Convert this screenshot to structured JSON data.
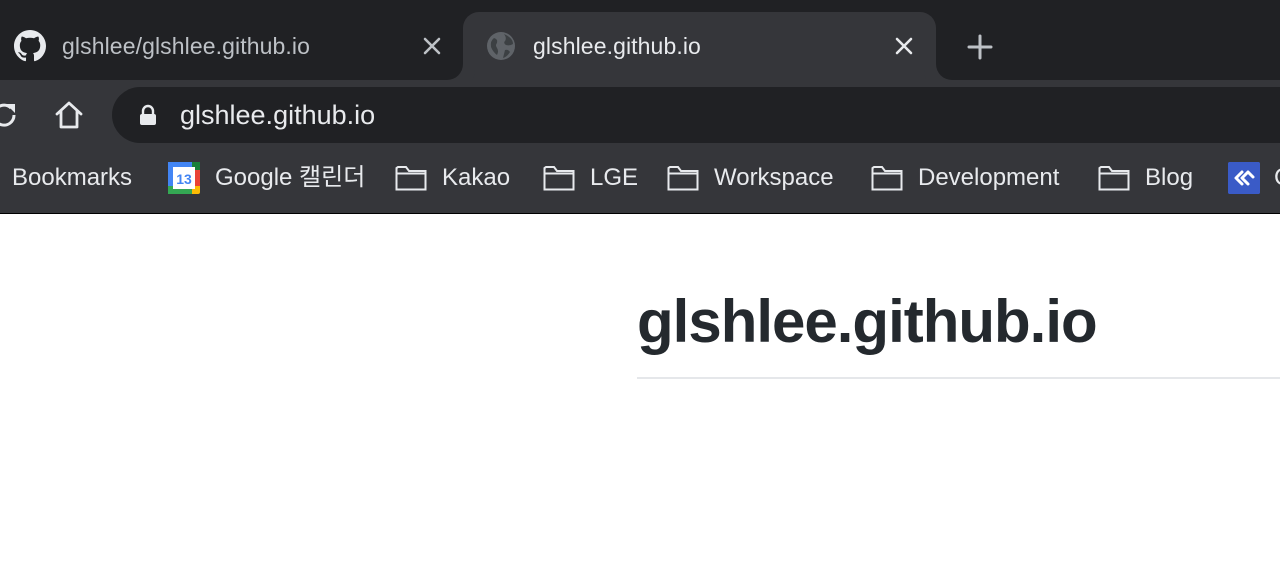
{
  "tabs": [
    {
      "title": "glshlee/glshlee.github.io",
      "icon": "github-icon",
      "active": false
    },
    {
      "title": "glshlee.github.io",
      "icon": "globe-icon",
      "active": true
    }
  ],
  "toolbar": {
    "url": "glshlee.github.io"
  },
  "bookmarks": {
    "items": [
      {
        "label": "Bookmarks"
      },
      {
        "label": "Google 캘린더",
        "icon": "calendar-icon",
        "day": "13"
      },
      {
        "label": "Kakao",
        "icon": "folder-icon"
      },
      {
        "label": "LGE",
        "icon": "folder-icon"
      },
      {
        "label": "Workspace",
        "icon": "folder-icon"
      },
      {
        "label": "Development",
        "icon": "folder-icon"
      },
      {
        "label": "Blog",
        "icon": "folder-icon"
      },
      {
        "label": "C",
        "icon": "confluence-icon"
      }
    ]
  },
  "page": {
    "title": "glshlee.github.io"
  },
  "colors": {
    "tabstrip_bg": "#202124",
    "toolbar_bg": "#35363a",
    "omnibox_bg": "#202124",
    "text_light": "#e8eaed",
    "page_title": "#24292e"
  }
}
